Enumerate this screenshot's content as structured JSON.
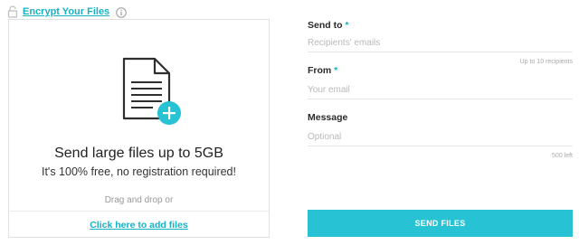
{
  "encrypt": {
    "link_label": "Encrypt Your Files",
    "icons": [
      "lock-icon",
      "info-icon"
    ]
  },
  "dropzone": {
    "icon": "document-add-icon",
    "headline": "Send large files up to 5GB",
    "subline": "It's 100% free, no registration required!",
    "drag_hint": "Drag and drop or",
    "add_files_label": "Click here to add files"
  },
  "form": {
    "send_to": {
      "label": "Send to",
      "required_mark": "*",
      "placeholder": "Recipients' emails",
      "value": "",
      "hint": "Up to 10 recipients"
    },
    "from": {
      "label": "From",
      "required_mark": "*",
      "placeholder": "Your email",
      "value": ""
    },
    "message": {
      "label": "Message",
      "placeholder": "Optional",
      "value": "",
      "hint": "500 left"
    },
    "submit_label": "SEND FILES"
  },
  "colors": {
    "accent": "#17b1c4",
    "button": "#27c2d3",
    "border": "#e1e1e1"
  }
}
